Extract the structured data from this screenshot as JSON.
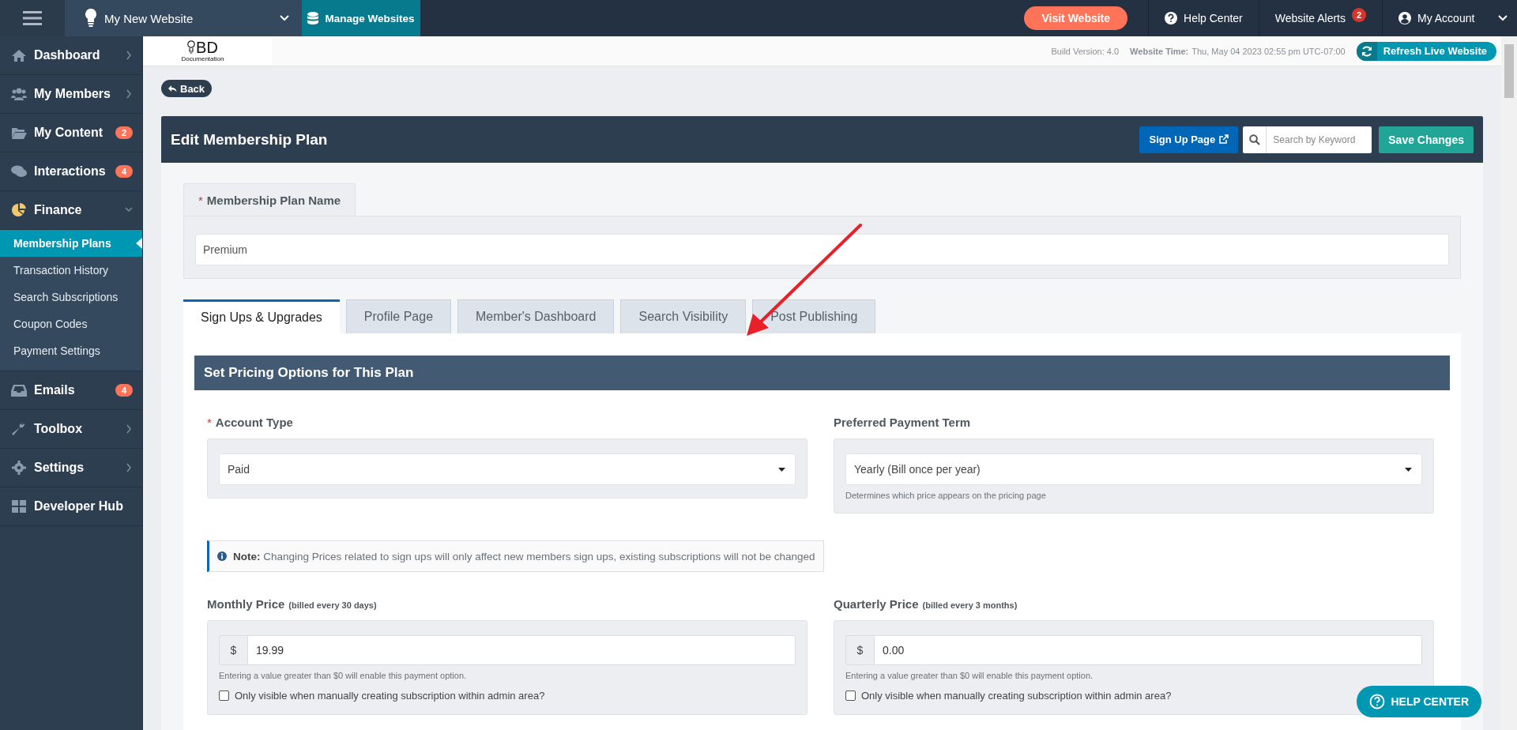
{
  "topbar": {
    "website_name": "My New Website",
    "manage_button": "Manage Websites",
    "visit_button": "Visit Website",
    "help_center": "Help Center",
    "alerts": {
      "label": "Website Alerts",
      "count": "2"
    },
    "account": "My Account"
  },
  "sidebar": [
    {
      "label": "Dashboard",
      "expanded": false
    },
    {
      "label": "My Members",
      "expanded": false
    },
    {
      "label": "My Content",
      "badge": "2"
    },
    {
      "label": "Interactions",
      "badge": "4"
    },
    {
      "label": "Finance",
      "expanded": true,
      "children": [
        {
          "label": "Membership Plans",
          "selected": true
        },
        {
          "label": "Transaction History",
          "selected": false
        },
        {
          "label": "Search Subscriptions",
          "selected": false
        },
        {
          "label": "Coupon Codes",
          "selected": false
        },
        {
          "label": "Payment Settings",
          "selected": false
        }
      ]
    },
    {
      "label": "Emails",
      "badge": "4"
    },
    {
      "label": "Toolbox",
      "expanded": false
    },
    {
      "label": "Settings",
      "expanded": false
    },
    {
      "label": "Developer Hub"
    }
  ],
  "info_bar": {
    "logo_text": "BD",
    "logo_caption": "Documentation",
    "build_version": "Build Version: 4.0",
    "time_label": "Website Time:",
    "time_value": "Thu, May 04 2023 02:55 pm UTC-07:00",
    "refresh_button": "Refresh Live Website"
  },
  "back_button": "Back",
  "page": {
    "title": "Edit Membership Plan",
    "signup_button": "Sign Up Page",
    "search": {
      "placeholder": "Search by Keyword"
    },
    "save_button": "Save Changes"
  },
  "plan_name": {
    "mark": "*",
    "label": "Membership Plan Name",
    "value": "Premium"
  },
  "tabs": [
    {
      "label": "Sign Ups & Upgrades",
      "selected": true
    },
    {
      "label": "Profile Page",
      "selected": false
    },
    {
      "label": "Member's Dashboard",
      "selected": false
    },
    {
      "label": "Search Visibility",
      "selected": false
    },
    {
      "label": "Post Publishing",
      "selected": false
    }
  ],
  "section_title": "Set Pricing Options for This Plan",
  "selects": [
    {
      "mark": "*",
      "label": "Account Type",
      "value": "Paid"
    },
    {
      "label": "Preferred Payment Term",
      "value": "Yearly (Bill once per year)",
      "help": "Determines which price appears on the pricing page"
    }
  ],
  "note": "**Note:** Changing Prices related to sign ups will only affect new members sign ups, existing subscriptions will not be changed",
  "prices": [
    {
      "label": "Monthly Price",
      "hint": "(billed every 30 days)",
      "currency": "$",
      "value": "19.99",
      "help": "Entering a value greater than $0 will enable this payment option.",
      "checkbox": {
        "label": "Only visible when manually creating subscription within admin area?",
        "checked": false
      }
    },
    {
      "label": "Quarterly Price",
      "hint": "(billed every 3 months)",
      "currency": "$",
      "value": "0.00",
      "help": "Entering a value greater than $0 will enable this payment option.",
      "checkbox": {
        "label": "Only visible when manually creating subscription within admin area?",
        "checked": false
      }
    }
  ],
  "help_button": "HELP CENTER"
}
